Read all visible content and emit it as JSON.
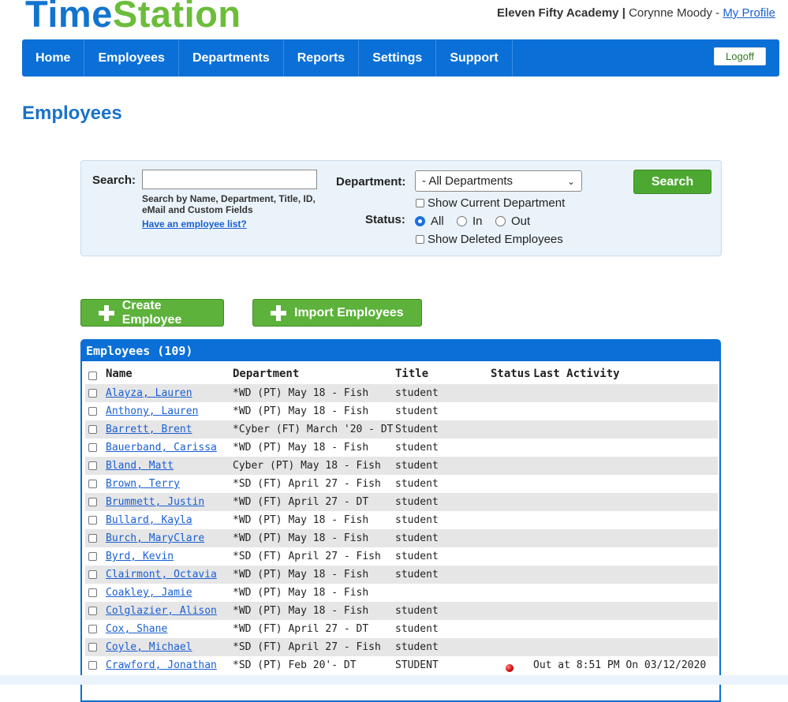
{
  "brand": {
    "part1": "Time",
    "part2": "Station"
  },
  "account": {
    "org": "Eleven Fifty Academy",
    "separator": "|",
    "user": "Corynne Moody",
    "dash": "-",
    "profile_link": "My Profile"
  },
  "nav": {
    "items": [
      "Home",
      "Employees",
      "Departments",
      "Reports",
      "Settings",
      "Support"
    ],
    "logoff": "Logoff"
  },
  "page": {
    "title": "Employees"
  },
  "search": {
    "label": "Search:",
    "value": "",
    "hint": "Search by Name, Department, Title, ID, eMail and Custom Fields",
    "list_link": "Have an employee list?",
    "department_label": "Department:",
    "department_selected": "- All Departments",
    "show_current_department": "Show Current Department",
    "status_label": "Status:",
    "status_options": [
      "All",
      "In",
      "Out"
    ],
    "status_selected": "All",
    "show_deleted": "Show Deleted Employees",
    "button": "Search"
  },
  "actions": {
    "create": "Create Employee",
    "import": "Import Employees"
  },
  "table": {
    "heading": "Employees (109)",
    "columns": {
      "name": "Name",
      "department": "Department",
      "title": "Title",
      "status": "Status",
      "last_activity": "Last Activity"
    },
    "rows": [
      {
        "name": "Alayza, Lauren",
        "department": "*WD (PT) May 18 - Fish",
        "title": "student",
        "status": "",
        "activity": ""
      },
      {
        "name": "Anthony, Lauren",
        "department": "*WD (PT) May 18 - Fish",
        "title": "student",
        "status": "",
        "activity": ""
      },
      {
        "name": "Barrett, Brent",
        "department": "*Cyber (FT) March '20 - DT",
        "title": "Student",
        "status": "",
        "activity": ""
      },
      {
        "name": "Bauerband, Carissa",
        "department": "*WD (PT) May 18 - Fish",
        "title": "student",
        "status": "",
        "activity": ""
      },
      {
        "name": "Bland, Matt",
        "department": "Cyber (PT) May 18 - Fish",
        "title": "student",
        "status": "",
        "activity": ""
      },
      {
        "name": "Brown, Terry",
        "department": "*SD (FT) April 27 - Fish",
        "title": "student",
        "status": "",
        "activity": ""
      },
      {
        "name": "Brummett, Justin",
        "department": "*WD (FT) April 27 - DT",
        "title": "student",
        "status": "",
        "activity": ""
      },
      {
        "name": "Bullard, Kayla",
        "department": "*WD (PT) May 18 - Fish",
        "title": "student",
        "status": "",
        "activity": ""
      },
      {
        "name": "Burch, MaryClare",
        "department": "*WD (PT) May 18 - Fish",
        "title": "student",
        "status": "",
        "activity": ""
      },
      {
        "name": "Byrd, Kevin",
        "department": "*SD (FT) April 27 - Fish",
        "title": "student",
        "status": "",
        "activity": ""
      },
      {
        "name": "Clairmont, Octavia",
        "department": "*WD (PT) May 18 - Fish",
        "title": "student",
        "status": "",
        "activity": ""
      },
      {
        "name": "Coakley, Jamie",
        "department": "*WD (PT) May 18 - Fish",
        "title": "",
        "status": "",
        "activity": ""
      },
      {
        "name": "Colglazier, Alison",
        "department": "*WD (PT) May 18 - Fish",
        "title": "student",
        "status": "",
        "activity": ""
      },
      {
        "name": "Cox, Shane",
        "department": "*WD (FT) April 27 - DT",
        "title": "student",
        "status": "",
        "activity": ""
      },
      {
        "name": "Coyle, Michael",
        "department": "*SD (FT) April 27 - Fish",
        "title": "student",
        "status": "",
        "activity": ""
      },
      {
        "name": "Crawford, Jonathan",
        "department": "*SD (PT) Feb 20'- DT",
        "title": "STUDENT",
        "status": "out",
        "activity": "Out at 8:51 PM On 03/12/2020"
      }
    ]
  },
  "colors": {
    "brand_blue": "#0a6fd6",
    "brand_green": "#5cb23a",
    "status_out": "#d10000"
  }
}
